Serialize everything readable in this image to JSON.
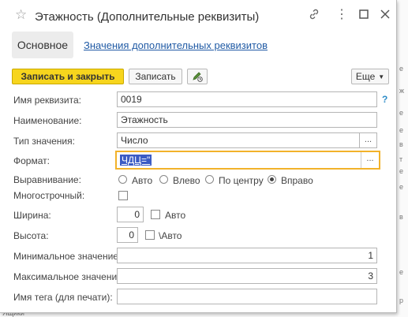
{
  "window": {
    "title": "Этажность (Дополнительные реквизиты)",
    "icons": [
      "star-icon",
      "link-icon",
      "more-icon",
      "maximize-icon",
      "close-icon"
    ]
  },
  "tabs": {
    "main": "Основное",
    "values_link": "Значения дополнительных реквизитов"
  },
  "toolbar": {
    "save_close": "Записать и закрыть",
    "save": "Записать",
    "more": "Еще"
  },
  "fields": {
    "name_label": "Имя реквизита:",
    "name_value": "0019",
    "help": "?",
    "title_label": "Наименование:",
    "title_value": "Этажность",
    "type_label": "Тип значения:",
    "type_value": "Число",
    "format_label": "Формат:",
    "format_value": "ЧДЦ=\"",
    "align_label": "Выравнивание:",
    "align_options": [
      "Авто",
      "Влево",
      "По центру",
      "Вправо"
    ],
    "align_selected": "Вправо",
    "multiline_label": "Многострочный:",
    "width_label": "Ширина:",
    "width_value": "0",
    "width_auto": "Авто",
    "height_label": "Высота:",
    "height_value": "0",
    "height_auto": "\\Авто",
    "min_label": "Минимальное значение:",
    "min_value": "1",
    "max_label": "Максимальное значение:",
    "max_value": "3",
    "tag_label": "Имя тега (для печати):",
    "tag_value": ""
  },
  "background": {
    "right_strip": [
      "е",
      "ж",
      "е",
      "е",
      "в",
      "т",
      "е",
      "е",
      "в",
      "е",
      "р"
    ],
    "bottom_left": "Ящики"
  },
  "colors": {
    "primary_button": "#f7d51d",
    "focus_border": "#f2b22a",
    "link": "#215ba5",
    "help": "#2f8dc8",
    "selection": "#3b5bc4"
  }
}
